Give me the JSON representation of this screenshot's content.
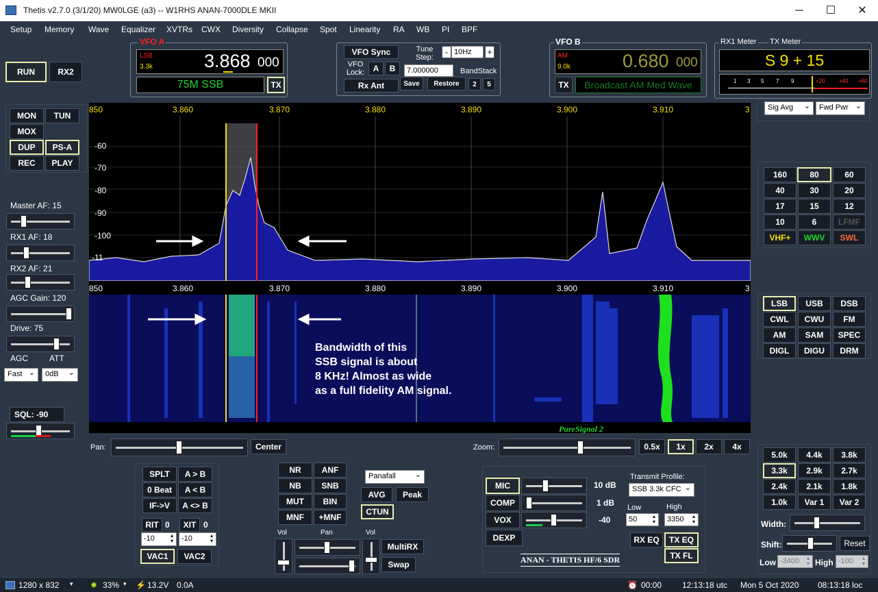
{
  "window": {
    "title": "Thetis v2.7.0 (3/1/20) MW0LGE (a3)   --   W1RHS ANAN-7000DLE MKII",
    "minimize": "─",
    "maximize": "☐",
    "close": "✕"
  },
  "menu": [
    "Setup",
    "Memory",
    "Wave",
    "Equalizer",
    "XVTRs",
    "CWX",
    "Diversity",
    "Collapse",
    "Spot",
    "Linearity",
    "RA",
    "WB",
    "PI",
    "BPF"
  ],
  "left": {
    "run": "RUN",
    "rx2": "RX2",
    "mon": "MON",
    "tun": "TUN",
    "mox": "MOX",
    "dup": "DUP",
    "psa": "PS-A",
    "rec": "REC",
    "play": "PLAY",
    "master_af": "Master AF:  15",
    "rx1_af": "RX1 AF:  18",
    "rx2_af": "RX2 AF:  21",
    "agc_gain": "AGC Gain:  120",
    "drive": "Drive:  75",
    "agc_label": "AGC",
    "att_label": "ATT",
    "agc_value": "Fast",
    "att_value": "0dB",
    "sql": "SQL:  -90"
  },
  "vfoa": {
    "label": "VFO A",
    "mode": "LSB",
    "bw": "3.3k",
    "freq_main": "3.868",
    "freq_sub": "000",
    "band": "75M SSB",
    "tx": "TX"
  },
  "center": {
    "vfo_sync": "VFO Sync",
    "tune_step": "Tune Step:",
    "step_value": "10Hz",
    "minus": "-",
    "plus": "+",
    "vfo_lock": "VFO Lock:",
    "a": "A",
    "b": "B",
    "freq_input": "7.000000",
    "bandstack": "BandStack",
    "rx_ant": "Rx Ant",
    "save": "Save",
    "restore": "Restore",
    "bs2": "2",
    "bs5": "5"
  },
  "vfob": {
    "label": "VFO B",
    "mode": "AM",
    "bw": "9.0k",
    "freq_main": "0.680",
    "freq_sub": "000",
    "tx": "TX",
    "band": "Broadcast AM Med Wave"
  },
  "meters": {
    "rx1_label": "RX1 Meter",
    "tx_label": "TX Meter",
    "reading": "S 9 + 15",
    "scale": [
      "1",
      "3",
      "5",
      "7",
      "9",
      "+20",
      "+40",
      "+60"
    ],
    "sig_avg": "Sig Avg",
    "fwd_pwr": "Fwd Pwr"
  },
  "spectrum": {
    "freq_labels": [
      "850",
      "3.860",
      "3.870",
      "3.880",
      "3.890",
      "3.900",
      "3.910",
      "3"
    ],
    "db_labels": [
      "-60",
      "-70",
      "-80",
      "-90",
      "-100",
      "-11"
    ],
    "annotation": [
      "Bandwidth of this",
      "SSB signal is about",
      "8 KHz!  Almost as wide",
      "as a full fidelity AM signal."
    ],
    "puresignal": "PureSignal 2"
  },
  "bands": [
    "160",
    "80",
    "60",
    "40",
    "30",
    "20",
    "17",
    "15",
    "12",
    "10",
    "6",
    "LFMF",
    "VHF+",
    "WWV",
    "SWL"
  ],
  "modes": [
    "LSB",
    "USB",
    "DSB",
    "CWL",
    "CWU",
    "FM",
    "AM",
    "SAM",
    "SPEC",
    "DIGL",
    "DIGU",
    "DRM"
  ],
  "filters": [
    "5.0k",
    "4.4k",
    "3.8k",
    "3.3k",
    "2.9k",
    "2.7k",
    "2.4k",
    "2.1k",
    "1.8k",
    "1.0k",
    "Var 1",
    "Var 2"
  ],
  "filter_ctl": {
    "width": "Width:",
    "shift": "Shift:",
    "reset": "Reset",
    "low": "Low",
    "low_val": "-3400",
    "high": "High",
    "high_val": "-100"
  },
  "pan": {
    "pan_label": "Pan:",
    "center": "Center",
    "zoom_label": "Zoom:",
    "z05": "0.5x",
    "z1": "1x",
    "z2": "2x",
    "z4": "4x"
  },
  "rit": {
    "splt": "SPLT",
    "ab": "A > B",
    "zero_beat": "0 Beat",
    "a_lt_b": "A < B",
    "ifv": "IF->V",
    "a_sw_b": "A <> B",
    "rit": "RIT",
    "rit_v": "0",
    "xit": "XIT",
    "xit_v": "0",
    "rit_val": "-10",
    "xit_val": "-10",
    "vac1": "VAC1",
    "vac2": "VAC2"
  },
  "dsp": {
    "nr": "NR",
    "anf": "ANF",
    "nb": "NB",
    "snb": "SNB",
    "mut": "MUT",
    "bin": "BIN",
    "mnf": "MNF",
    "pmnf": "+MNF",
    "display": "Panafall",
    "avg": "AVG",
    "peak": "Peak",
    "ctun": "CTUN",
    "vol": "Vol",
    "pan": "Pan",
    "vol2": "Vol",
    "multirx": "MultiRX",
    "swap": "Swap"
  },
  "tx": {
    "mic": "MIC",
    "mic_db": "10 dB",
    "comp": "COMP",
    "comp_db": "1 dB",
    "vox": "VOX",
    "vox_db": "-40",
    "dexp": "DEXP",
    "profile_label": "Transmit Profile:",
    "profile": "SSB 3.3k CFC",
    "low": "Low",
    "high": "High",
    "low_v": "50",
    "high_v": "3350",
    "rxeq": "RX EQ",
    "txeq": "TX EQ",
    "txfl": "TX FL",
    "brand": "ANAN - THETIS HF/6 SDR"
  },
  "status": {
    "res": "1280 x 832",
    "cpu": "33%",
    "volt": "13.2V",
    "amp": "0.0A",
    "timer": "00:00",
    "utc": "12:13:18 utc",
    "date": "Mon 5 Oct 2020",
    "loc": "08:13:18 loc"
  },
  "colors": {
    "bg": "#2b3745",
    "accent_yellow": "#f5e000",
    "vfoa_red": "#ff2020",
    "green_text": "#22d430",
    "vfob_olive": "#9a9b3a",
    "spectrum_fill": "#1a1aa0"
  }
}
